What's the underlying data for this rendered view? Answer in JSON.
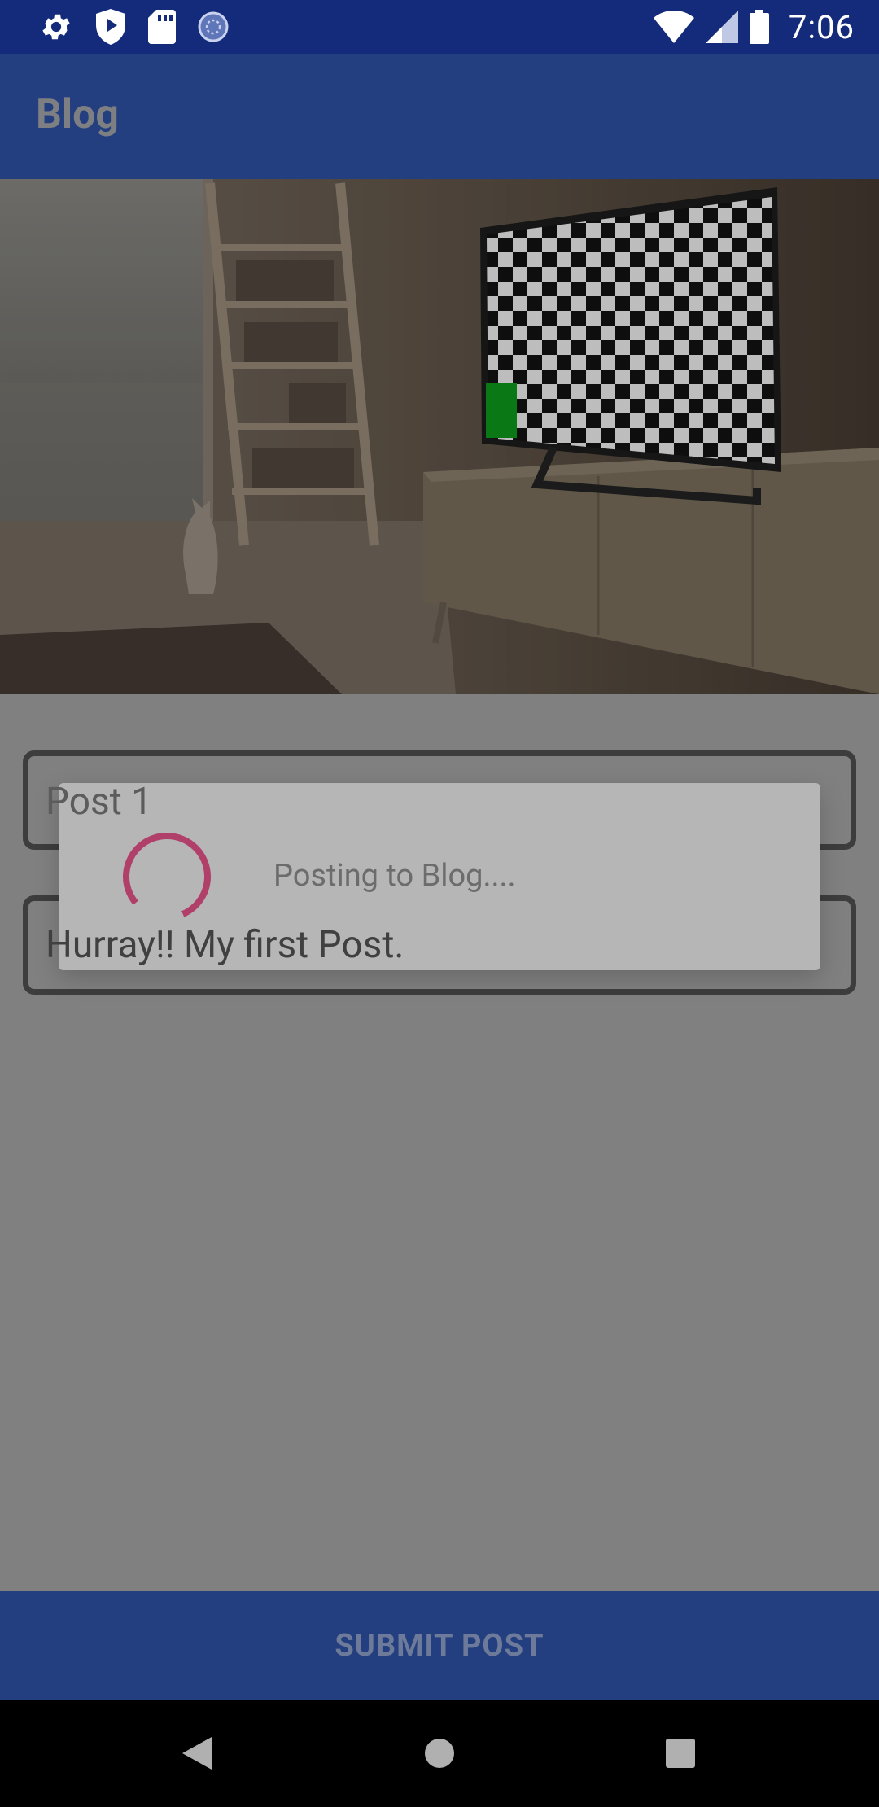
{
  "status_bar": {
    "time": "7:06",
    "left_icons": [
      "gear-icon",
      "shield-play-icon",
      "sd-card-icon",
      "sync-icon"
    ],
    "right_icons": [
      "wifi-icon",
      "signal-icon",
      "battery-icon"
    ]
  },
  "app_bar": {
    "title": "Blog"
  },
  "hero_image": {
    "description": "room-with-ladder-shelf-cat-and-tv"
  },
  "form": {
    "title_value": "Post 1",
    "body_value": "Hurray!! My first Post."
  },
  "dialog": {
    "message": "Posting to Blog....",
    "spinner_color": "#b0406a"
  },
  "submit": {
    "label": "SUBMIT POST"
  },
  "colors": {
    "status_bar": "#142a7a",
    "app_bar": "#233f7f",
    "scrim": "#808080"
  }
}
